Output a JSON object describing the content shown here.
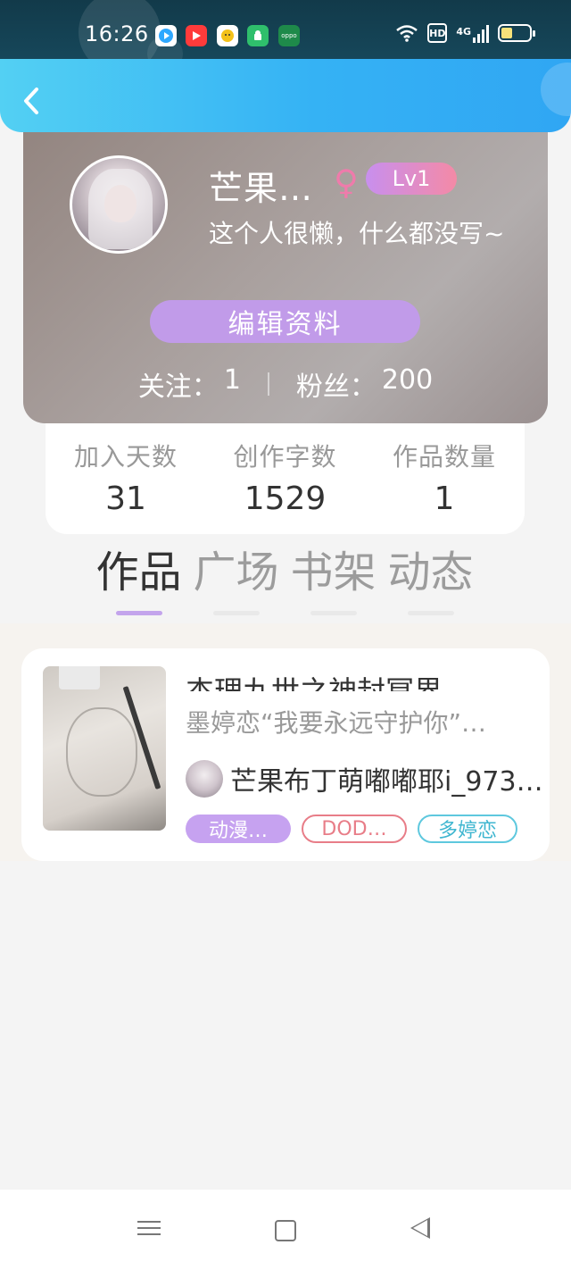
{
  "status_bar": {
    "time": "16:26",
    "apps": [
      {
        "icon": "video-app-icon",
        "color": "#2ea8ff"
      },
      {
        "icon": "play-app-icon",
        "color": "#ff3b3b"
      },
      {
        "icon": "chat-bot-app-icon",
        "color": "#f4c21a"
      },
      {
        "icon": "android-app-icon",
        "color": "#2fbf6c"
      },
      {
        "icon": "oppo-app-icon",
        "color": "#1e8a4a"
      }
    ],
    "hd": "HD",
    "network": "4G"
  },
  "profile": {
    "username": "芒果…",
    "gender_symbol": "♀",
    "level": "Lv1",
    "bio": "这个人很懒，什么都没写~",
    "edit_button": "编辑资料",
    "following_label": "关注：",
    "following_count": "1",
    "followers_label": "粉丝：",
    "followers_count": "200"
  },
  "stats": [
    {
      "label": "加入天数",
      "value": "31"
    },
    {
      "label": "创作字数",
      "value": "1529"
    },
    {
      "label": "作品数量",
      "value": "1"
    }
  ],
  "tabs": [
    {
      "label": "作品",
      "active": true
    },
    {
      "label": "广场",
      "active": false
    },
    {
      "label": "书架",
      "active": false
    },
    {
      "label": "动态",
      "active": false
    }
  ],
  "work": {
    "title": "杰理九世之神封冥界",
    "description": "墨婷恋“我要永远守护你”…",
    "author": "芒果布丁萌嘟嘟耶i_973…",
    "tags": [
      "动漫…",
      "DOD…",
      "多婷恋"
    ]
  },
  "colors": {
    "accent": "#35b2f4",
    "purple": "#c19be9",
    "pink": "#ef7bab"
  }
}
